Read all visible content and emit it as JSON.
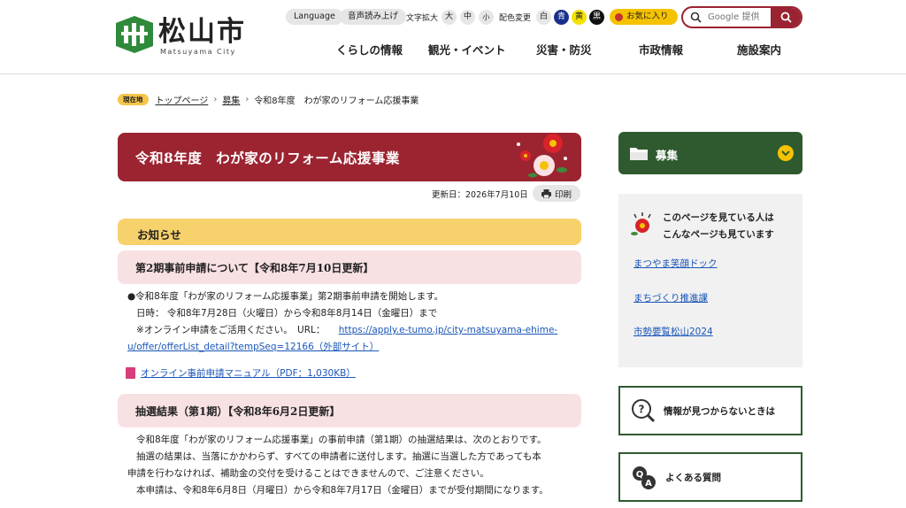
{
  "header": {
    "logo_name": "松山市",
    "logo_sub": "Matsuyama City",
    "utility": {
      "language": "Language",
      "voice": "音声読み上げ",
      "text_size_label": "文字拡大",
      "size_large": "大",
      "size_medium": "中",
      "size_small": "小",
      "color_label": "配色変更",
      "color_white": "白",
      "color_blue": "青",
      "color_yellow": "黄",
      "color_black": "黒",
      "favorite": "お気に入り"
    },
    "search": {
      "placeholder": "Google 提供"
    },
    "nav": [
      "くらしの情報",
      "観光・イベント",
      "災害・防災",
      "市政情報",
      "施設案内"
    ]
  },
  "breadcrumb": {
    "here": "現在地",
    "items": [
      "トップページ",
      "募集",
      "令和8年度　わが家のリフォーム応援事業"
    ]
  },
  "page": {
    "title": "令和8年度　わが家のリフォーム応援事業",
    "updated": "更新日：2026年7月10日",
    "print": "印刷",
    "notice": "お知らせ",
    "section1": {
      "heading": "第2期事前申請について【令和8年7月10日更新】",
      "line1": "●令和8年度「わが家のリフォーム応援事業」第2期事前申請を開始します。",
      "line2": "日時： 令和8年7月28日（火曜日）から令和8年8月14日（金曜日）まで",
      "line3_prefix": "※オンライン申請をご活用ください。　URL：",
      "url_part1": "https://apply.e-tumo.jp/city-matsuyama-ehime-",
      "url_part2": "u/offer/offerList_detail?tempSeq=12166（外部サイト）",
      "pdf_link": "オンライン事前申請マニュアル（PDF：1,030KB）"
    },
    "section2": {
      "heading": "抽選結果（第1期）【令和8年6月2日更新】",
      "line1": "令和8年度「わが家のリフォーム応援事業」の事前申請（第1期）の抽選結果は、次のとおりです。",
      "line2": "抽選の結果は、当落にかかわらず、すべての申請者に送付します。抽選に当選した方であっても本",
      "line3": "申請を行わなければ、補助金の交付を受けることはできませんので、ご注意ください。",
      "line4": "本申請は、令和8年6月8日（月曜日）から令和8年7月17日（金曜日）までが受付期間になります。"
    }
  },
  "sidebar": {
    "category": "募集",
    "also_viewed_line1": "このページを見ている人は",
    "also_viewed_line2": "こんなページも見ています",
    "links": [
      "まつやま笑顔ドック",
      "まちづくり推進課",
      "市勢要覧松山2024"
    ],
    "not_found": "情報が見つからないときは",
    "faq": "よくある質問"
  },
  "colors": {
    "brand_red": "#9c2431",
    "brand_green": "#2f5a2f",
    "accent_yellow": "#f5c200"
  }
}
